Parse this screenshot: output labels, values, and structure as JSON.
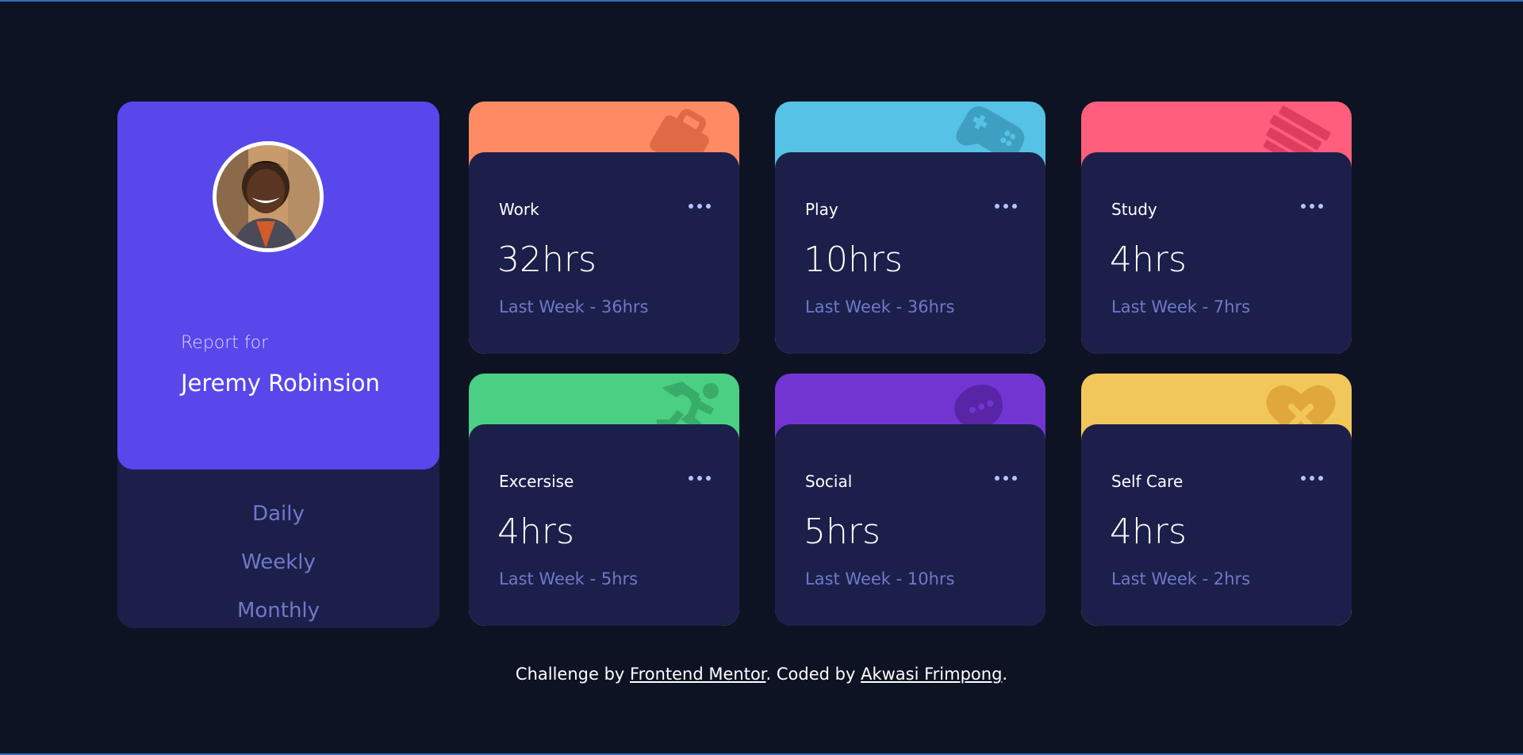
{
  "profile": {
    "report_for": "Report for",
    "name": "Jeremy Robinsion",
    "avatar_alt": "avatar"
  },
  "periods": [
    "Daily",
    "Weekly",
    "Monthly"
  ],
  "cards": [
    {
      "title": "Work",
      "current": "32hrs",
      "previous": "Last Week - 36hrs",
      "color": "#ff8b64",
      "icon": "briefcase-icon"
    },
    {
      "title": "Play",
      "current": "10hrs",
      "previous": "Last Week - 36hrs",
      "color": "#55c2e6",
      "icon": "game-controller-icon"
    },
    {
      "title": "Study",
      "current": "4hrs",
      "previous": "Last Week - 7hrs",
      "color": "#ff5e7d",
      "icon": "book-icon"
    },
    {
      "title": "Excersise",
      "current": "4hrs",
      "previous": "Last Week - 5hrs",
      "color": "#4bcf82",
      "icon": "running-person-icon"
    },
    {
      "title": "Social",
      "current": "5hrs",
      "previous": "Last Week - 10hrs",
      "color": "#7335d2",
      "icon": "chat-bubble-icon"
    },
    {
      "title": "Self Care",
      "current": "4hrs",
      "previous": "Last Week - 2hrs",
      "color": "#f1c75b",
      "icon": "heart-icon"
    }
  ],
  "footer": {
    "prefix": "Challenge by ",
    "link1": "Frontend Mentor",
    "middle": ". Coded by ",
    "link2": "Akwasi Frimpong",
    "suffix": "."
  }
}
